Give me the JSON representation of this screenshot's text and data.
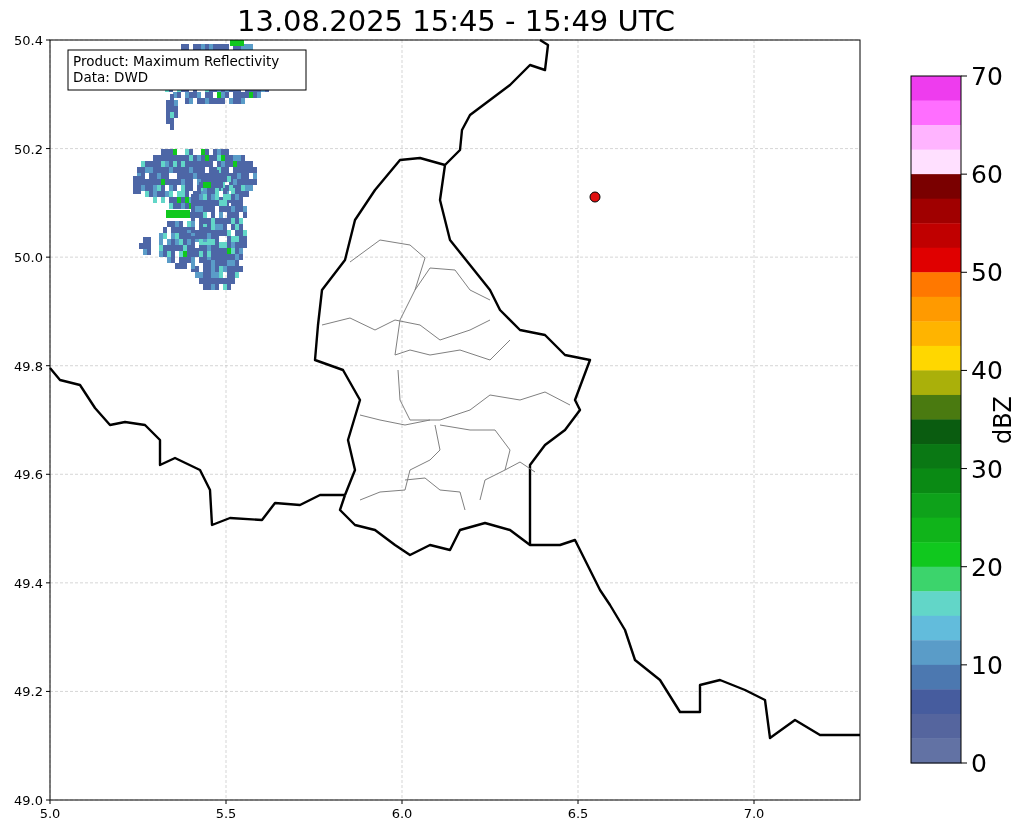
{
  "title": "13.08.2025 15:45 - 15:49 UTC",
  "info_box": [
    "Product: Maximum Reflectivity",
    "Data: DWD"
  ],
  "map": {
    "xticks": [
      "5.0",
      "5.5",
      "6.0",
      "6.5",
      "7.0"
    ],
    "yticks": [
      "50.4",
      "50.2",
      "50.0",
      "49.8",
      "49.6",
      "49.4",
      "49.2",
      "49.0"
    ]
  },
  "colorbar": {
    "label": "dBZ",
    "ticks": [
      "70",
      "60",
      "50",
      "40",
      "30",
      "20",
      "10",
      "0"
    ],
    "segments": [
      {
        "color": "#ee3cee"
      },
      {
        "color": "#ff6eff"
      },
      {
        "color": "#ffb4ff"
      },
      {
        "color": "#ffe0ff"
      },
      {
        "color": "#7a0000"
      },
      {
        "color": "#a00000"
      },
      {
        "color": "#c00000"
      },
      {
        "color": "#e00000"
      },
      {
        "color": "#ff7800"
      },
      {
        "color": "#ff9a00"
      },
      {
        "color": "#ffb400"
      },
      {
        "color": "#ffd700"
      },
      {
        "color": "#aab00a"
      },
      {
        "color": "#4a7a10"
      },
      {
        "color": "#0a5c10"
      },
      {
        "color": "#0a7814"
      },
      {
        "color": "#0a8a14"
      },
      {
        "color": "#0ea21a"
      },
      {
        "color": "#10b41a"
      },
      {
        "color": "#10c81e"
      },
      {
        "color": "#3cd46c"
      },
      {
        "color": "#62d6c8"
      },
      {
        "color": "#62bcdc"
      },
      {
        "color": "#5a9cc8"
      },
      {
        "color": "#4c78b0"
      },
      {
        "color": "#465c9e"
      },
      {
        "color": "#55659e"
      },
      {
        "color": "#6272a4"
      }
    ]
  }
}
